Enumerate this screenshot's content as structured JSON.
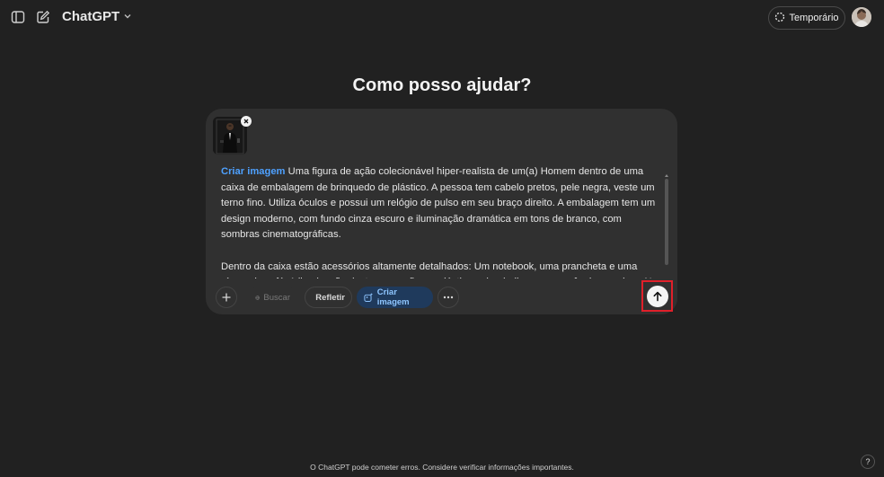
{
  "header": {
    "model_label": "ChatGPT",
    "temporary_label": "Temporário"
  },
  "main": {
    "heading": "Como posso ajudar?"
  },
  "composer": {
    "prompt_tag": "Criar imagem",
    "prompt_paragraph_1": " Uma figura de ação colecionável hiper-realista de um(a) Homem dentro de uma caixa de embalagem de brinquedo de plástico. A pessoa tem cabelo pretos, pele negra, veste um terno fino. Utiliza óculos e possui um relógio de pulso em seu braço direito. A embalagem tem um design moderno, com fundo cinza escuro e iluminação dramática em tons de branco, com sombras cinematográficas.",
    "prompt_paragraph_2": "Dentro da caixa estão acessórios altamente detalhados: Um notebook, uma prancheta e uma xícara de café. A iluminação destaca os reflexos plásticos, dando-lhe uma aparência premium. No topo da",
    "tools": {
      "search_label": "Buscar",
      "think_label": "Refletir",
      "image_label": "Criar imagem"
    }
  },
  "footer": {
    "disclaimer": "O ChatGPT pode cometer erros. Considere verificar informações importantes.",
    "help_label": "?"
  },
  "colors": {
    "background": "#212121",
    "composer_bg": "#303030",
    "accent_blue": "#4ea1ff",
    "highlight_red": "#e0202a"
  }
}
